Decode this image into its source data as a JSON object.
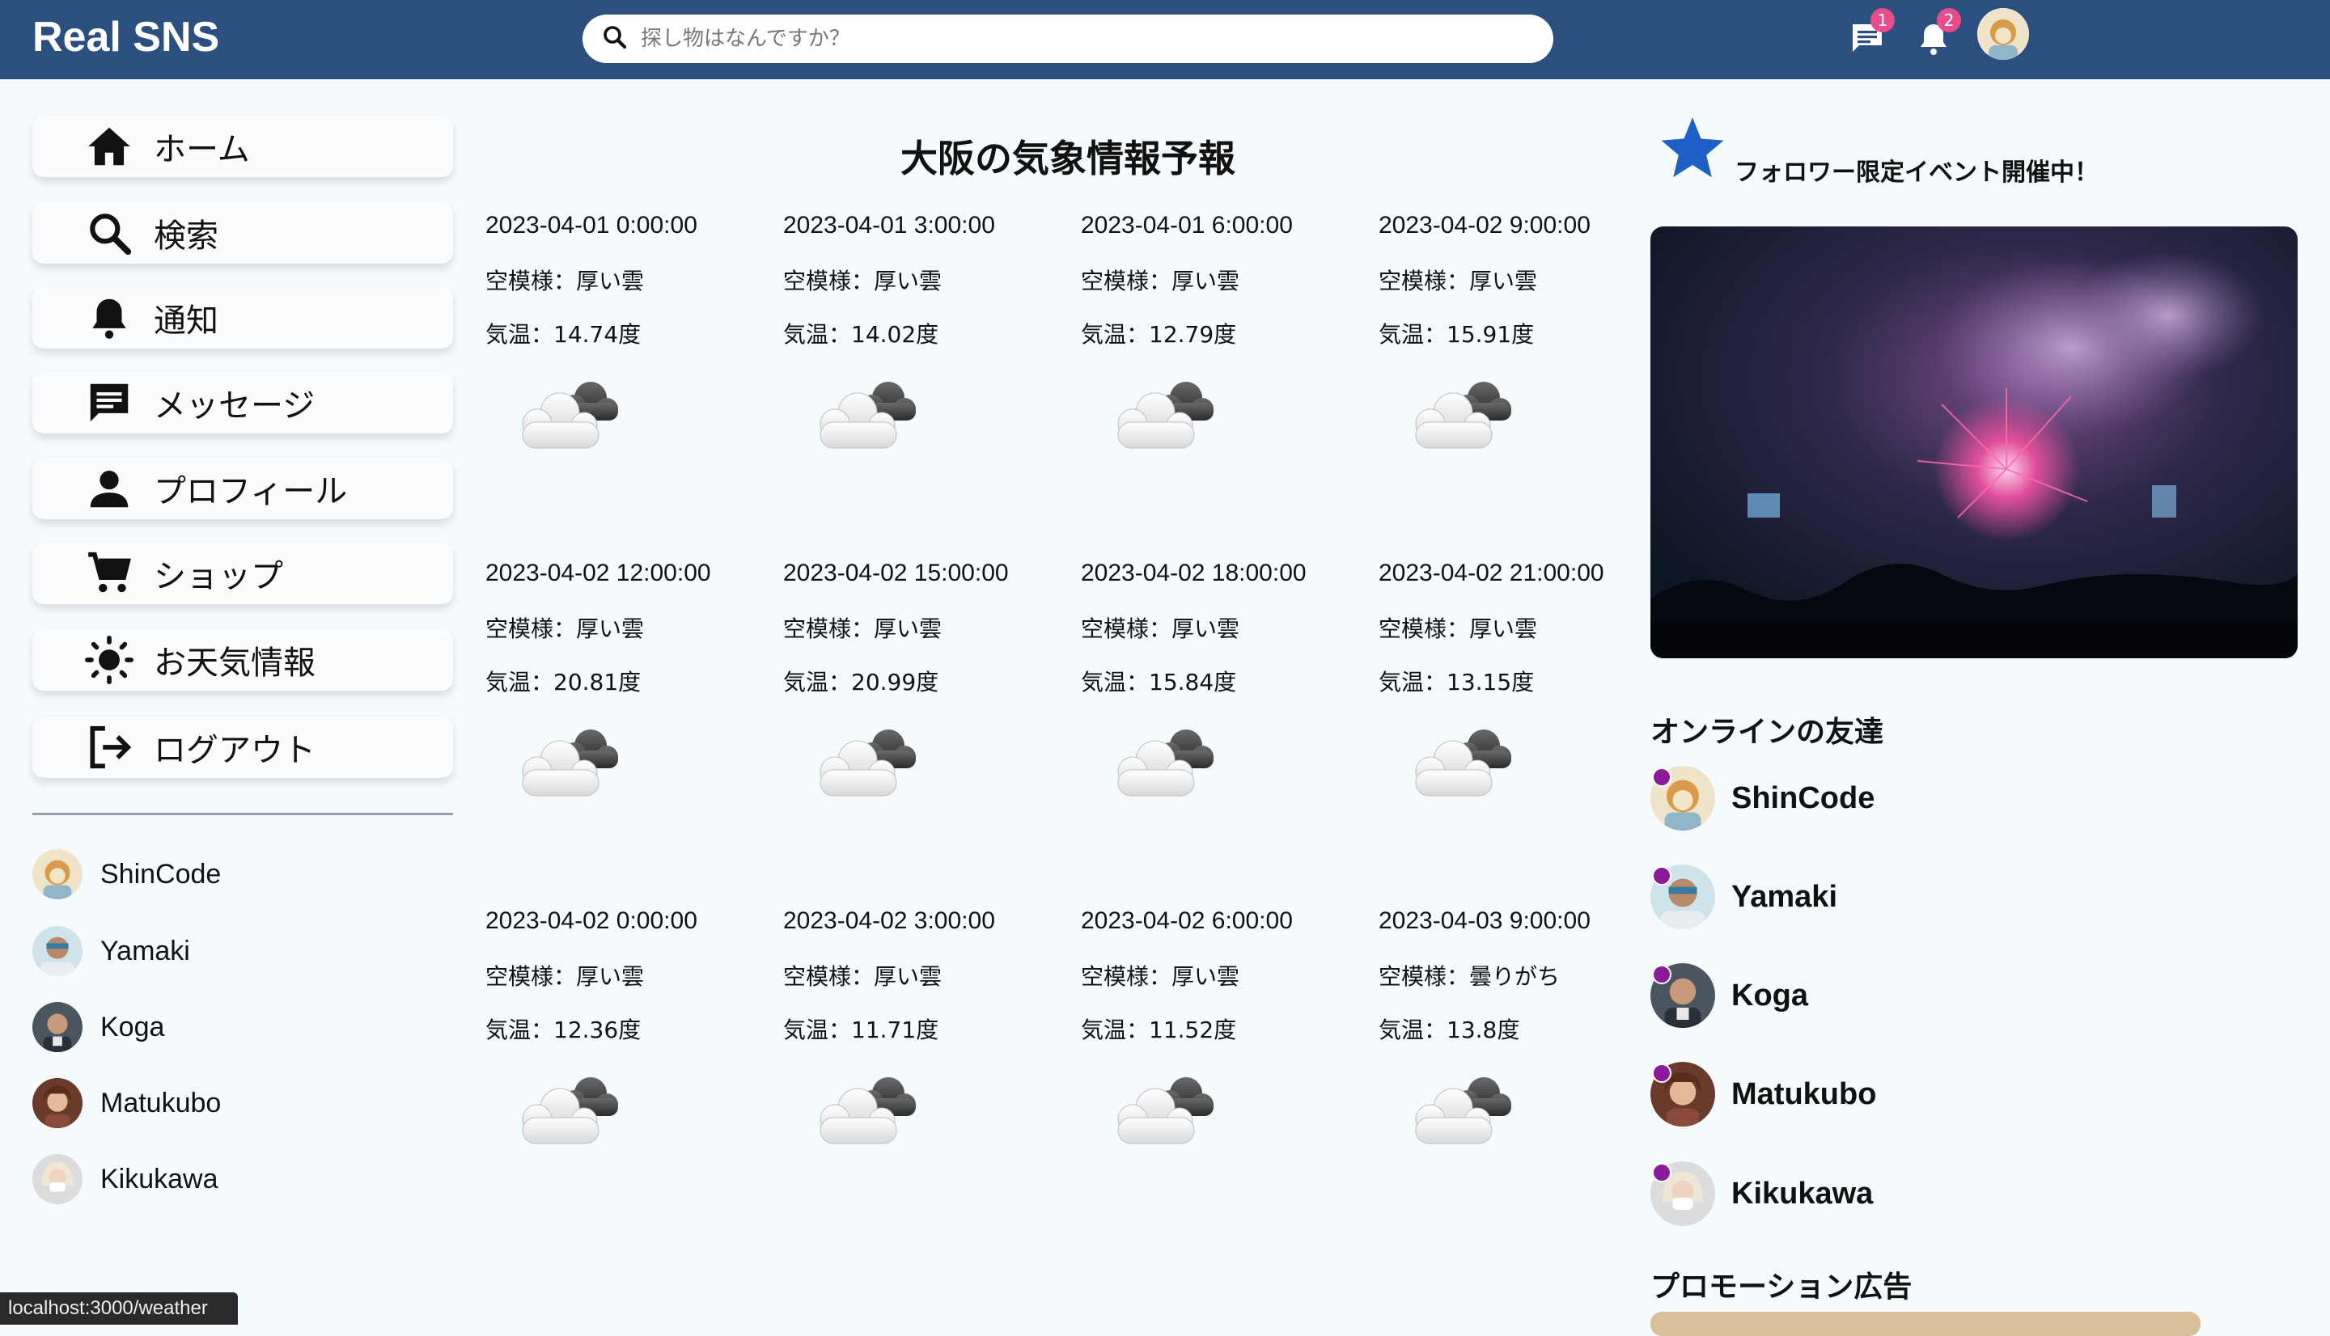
{
  "app": {
    "title": "Real SNS"
  },
  "search": {
    "placeholder": "探し物はなんですか？"
  },
  "header": {
    "message_badge": "1",
    "notification_badge": "2"
  },
  "sidebar": {
    "items": [
      {
        "label": "ホーム",
        "icon": "home-icon"
      },
      {
        "label": "検索",
        "icon": "search-icon"
      },
      {
        "label": "通知",
        "icon": "bell-icon"
      },
      {
        "label": "メッセージ",
        "icon": "chat-icon"
      },
      {
        "label": "プロフィール",
        "icon": "person-icon"
      },
      {
        "label": "ショップ",
        "icon": "cart-icon"
      },
      {
        "label": "お天気情報",
        "icon": "sun-icon"
      },
      {
        "label": "ログアウト",
        "icon": "logout-icon"
      }
    ],
    "friends": [
      "ShinCode",
      "Yamaki",
      "Koga",
      "Matukubo",
      "Kikukawa"
    ]
  },
  "weather": {
    "title": "大阪の気象情報予報",
    "cards": [
      {
        "datetime": "2023-04-01 0:00:00",
        "condition": "空模様：厚い雲",
        "temp": "気温：14.74度"
      },
      {
        "datetime": "2023-04-01 3:00:00",
        "condition": "空模様：厚い雲",
        "temp": "気温：14.02度"
      },
      {
        "datetime": "2023-04-01 6:00:00",
        "condition": "空模様：厚い雲",
        "temp": "気温：12.79度"
      },
      {
        "datetime": "2023-04-02 9:00:00",
        "condition": "空模様：厚い雲",
        "temp": "気温：15.91度"
      },
      {
        "datetime": "2023-04-02 12:00:00",
        "condition": "空模様：厚い雲",
        "temp": "気温：20.81度"
      },
      {
        "datetime": "2023-04-02 15:00:00",
        "condition": "空模様：厚い雲",
        "temp": "気温：20.99度"
      },
      {
        "datetime": "2023-04-02 18:00:00",
        "condition": "空模様：厚い雲",
        "temp": "気温：15.84度"
      },
      {
        "datetime": "2023-04-02 21:00:00",
        "condition": "空模様：厚い雲",
        "temp": "気温：13.15度"
      },
      {
        "datetime": "2023-04-02 0:00:00",
        "condition": "空模様：厚い雲",
        "temp": "気温：12.36度"
      },
      {
        "datetime": "2023-04-02 3:00:00",
        "condition": "空模様：厚い雲",
        "temp": "気温：11.71度"
      },
      {
        "datetime": "2023-04-02 6:00:00",
        "condition": "空模様：厚い雲",
        "temp": "気温：11.52度"
      },
      {
        "datetime": "2023-04-03 9:00:00",
        "condition": "空模様：曇りがち",
        "temp": "気温：13.8度"
      }
    ]
  },
  "rightbar": {
    "event_text": "フォロワー限定イベント開催中！",
    "online_title": "オンラインの友達",
    "online": [
      "ShinCode",
      "Yamaki",
      "Koga",
      "Matukubo",
      "Kikukawa"
    ],
    "promo_title": "プロモーション広告"
  },
  "status_url": "localhost:3000/weather",
  "colors": {
    "header": "#2b5080",
    "badge": "#e74c8b",
    "online_dot": "#8b1a9a",
    "star": "#1d5fc4"
  }
}
